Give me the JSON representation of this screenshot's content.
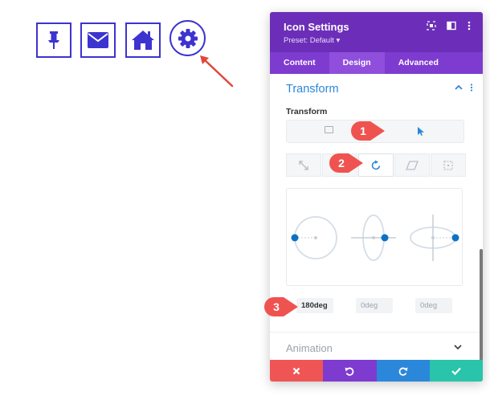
{
  "panel": {
    "title": "Icon Settings",
    "preset": "Preset: Default ▾"
  },
  "tabs": [
    {
      "label": "Content",
      "active": false
    },
    {
      "label": "Design",
      "active": true
    },
    {
      "label": "Advanced",
      "active": false
    }
  ],
  "section": {
    "title": "Transform",
    "field_label": "Transform"
  },
  "degrees": {
    "first": "180deg",
    "second": "0deg",
    "third": "0deg"
  },
  "animation": {
    "label": "Animation"
  },
  "callouts": [
    "1",
    "2",
    "3"
  ],
  "preview_icons": [
    "pin-icon",
    "envelope-icon",
    "home-icon",
    "gear-icon"
  ],
  "colors": {
    "purple_dark": "#6c2eb9",
    "purple_tab": "#7e3bd0",
    "accent_blue": "#2b87da",
    "icon_blue": "#3d33cf",
    "callout_red": "#ef5350",
    "cancel_red": "#ef5555",
    "undo_purple": "#7e3bd0",
    "redo_blue": "#2b87da",
    "save_green": "#29c4a9"
  }
}
